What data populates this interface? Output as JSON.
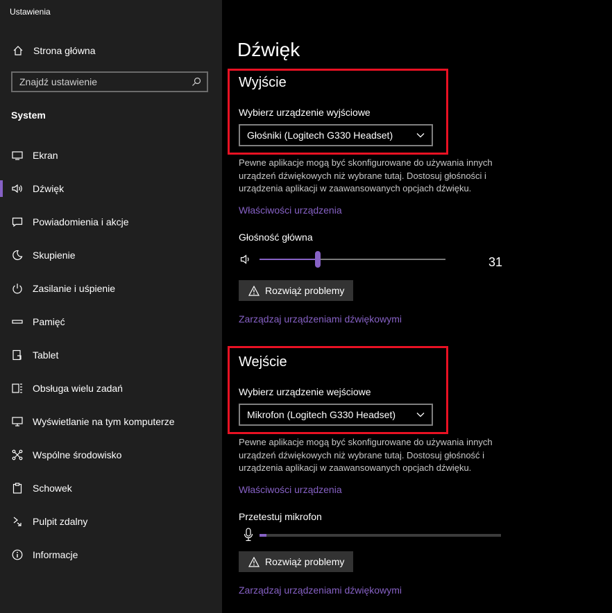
{
  "app": {
    "title": "Ustawienia"
  },
  "sidebar": {
    "home_label": "Strona główna",
    "search_placeholder": "Znajdź ustawienie",
    "section_label": "System",
    "items": [
      {
        "label": "Ekran",
        "icon": "display-icon"
      },
      {
        "label": "Dźwięk",
        "icon": "speaker-icon",
        "active": true
      },
      {
        "label": "Powiadomienia i akcje",
        "icon": "notification-icon"
      },
      {
        "label": "Skupienie",
        "icon": "moon-icon"
      },
      {
        "label": "Zasilanie i uśpienie",
        "icon": "power-icon"
      },
      {
        "label": "Pamięć",
        "icon": "storage-icon"
      },
      {
        "label": "Tablet",
        "icon": "tablet-icon"
      },
      {
        "label": "Obsługa wielu zadań",
        "icon": "multitasking-icon"
      },
      {
        "label": "Wyświetlanie na tym komputerze",
        "icon": "projecting-icon"
      },
      {
        "label": "Wspólne środowisko",
        "icon": "shared-experiences-icon"
      },
      {
        "label": "Schowek",
        "icon": "clipboard-icon"
      },
      {
        "label": "Pulpit zdalny",
        "icon": "remote-desktop-icon"
      },
      {
        "label": "Informacje",
        "icon": "info-icon"
      }
    ]
  },
  "main": {
    "title": "Dźwięk",
    "output": {
      "heading": "Wyjście",
      "select_label": "Wybierz urządzenie wyjściowe",
      "selected_device": "Głośniki (Logitech G330 Headset)",
      "description_lines": [
        "Pewne aplikacje mogą być skonfigurowane do używania innych",
        "urządzeń dźwiękowych niż wybrane tutaj. Dostosuj głośności i",
        "urządzenia aplikacji w zaawansowanych opcjach dźwięku."
      ],
      "properties_link": "Właściwości urządzenia",
      "volume_label": "Głośność główna",
      "volume_value": "31",
      "troubleshoot_label": "Rozwiąż problemy",
      "manage_link": "Zarządzaj urządzeniami dźwiękowymi"
    },
    "input": {
      "heading": "Wejście",
      "select_label": "Wybierz urządzenie wejściowe",
      "selected_device": "Mikrofon (Logitech G330 Headset)",
      "description_lines": [
        "Pewne aplikacje mogą być skonfigurowane do używania innych",
        "urządzeń dźwiękowych niż wybrane tutaj. Dostosuj głośność i",
        "urządzenia aplikacji w zaawansowanych opcjach dźwięku."
      ],
      "properties_link": "Właściwości urządzenia",
      "test_label": "Przetestuj mikrofon",
      "mic_level": 0.03,
      "troubleshoot_label": "Rozwiąż problemy",
      "manage_link": "Zarządzaj urządzeniami dźwiękowymi"
    }
  },
  "colors": {
    "accent": "#8661c5",
    "highlight_box": "#e81123",
    "sidebar_bg": "#1f1f1f",
    "main_bg": "#000000"
  }
}
